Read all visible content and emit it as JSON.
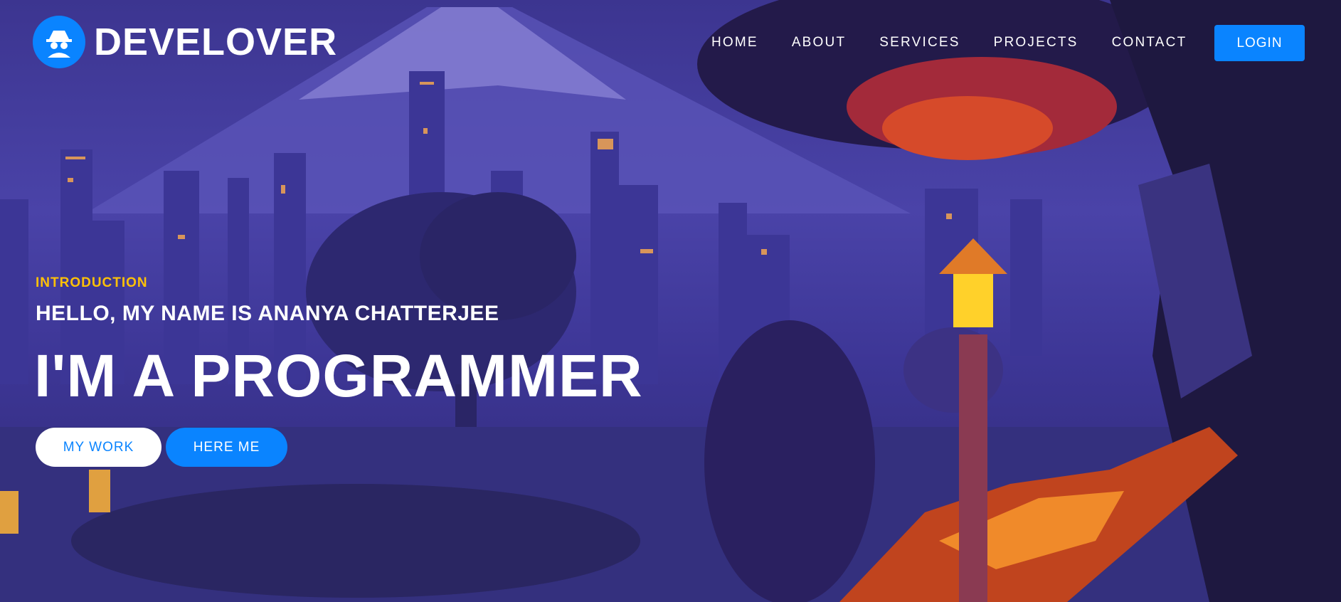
{
  "brand": {
    "name": "DEVELOVER",
    "icon": "spy-incognito-icon",
    "badge_color": "#0a84ff"
  },
  "nav": {
    "items": [
      "HOME",
      "ABOUT",
      "SERVICES",
      "PROJECTS",
      "CONTACT"
    ],
    "login_label": "LOGIN"
  },
  "hero": {
    "intro": "INTRODUCTION",
    "greeting": "HELLO, MY NAME IS ANANYA CHATTERJEE",
    "headline": "I'M A PROGRAMMER",
    "primary_button": "MY WORK",
    "secondary_button": "HERE ME"
  },
  "colors": {
    "accent": "#0a84ff",
    "intro_yellow": "#ffc107",
    "text": "#ffffff"
  }
}
